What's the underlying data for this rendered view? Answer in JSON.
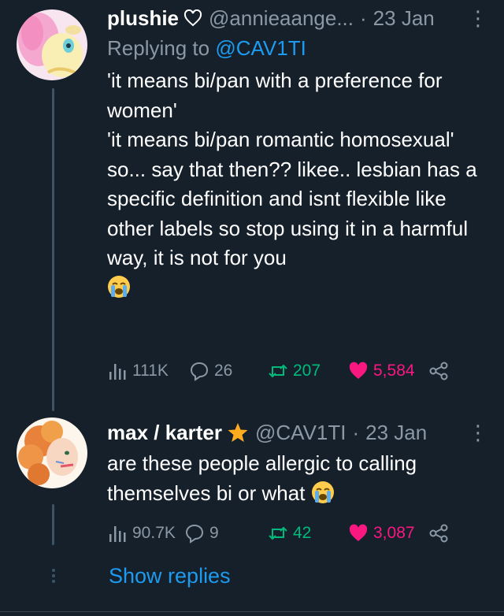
{
  "tweets": [
    {
      "name": "plushie",
      "name_icon": "heart-outline-icon",
      "handle": "@annieaange...",
      "separator": "·",
      "date": "23 Jan",
      "more": "⋮",
      "replying_prefix": "Replying to",
      "replying_to": "@CAV1TI",
      "lines": [
        "'it means bi/pan with a preference for women'",
        "'it means bi/pan romantic homosexual'",
        "so... say that then?? likee.. lesbian has a specific definition and isnt flexible like other labels so stop using it in a harmful way, it is not for you"
      ],
      "trailing_emoji": "loudly-crying-face-emoji",
      "views": "111K",
      "replies": "26",
      "retweets": "207",
      "likes": "5,584"
    },
    {
      "name": "max / karter",
      "name_icon": "star-icon",
      "handle": "@CAV1TI",
      "separator": "·",
      "date": "23 Jan",
      "more": "⋮",
      "text": "are these people allergic to calling themselves bi or what",
      "trailing_emoji": "loudly-crying-face-emoji",
      "views": "90.7K",
      "replies": "9",
      "retweets": "42",
      "likes": "3,087"
    }
  ],
  "show_replies": "Show replies",
  "colors": {
    "background": "#15202b",
    "secondary_text": "#8b98a5",
    "link": "#1d9bf0",
    "retweet": "#00ba7c",
    "like": "#f91880",
    "star": "#ffad1f"
  }
}
